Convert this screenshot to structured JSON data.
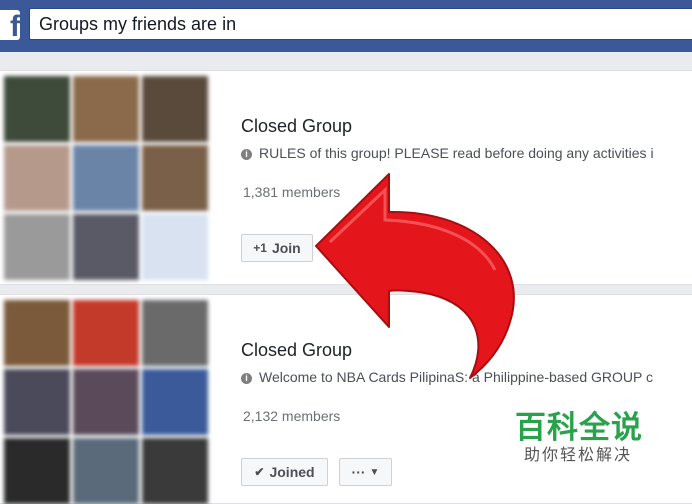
{
  "search": {
    "query": "Groups my friends are in"
  },
  "groups": [
    {
      "privacy": "Closed Group",
      "description": "RULES of this group! PLEASE read before doing any activities i",
      "members": "1,381 members",
      "join_label": "Join",
      "tiles": [
        "#3e4a3a",
        "#8a6a4a",
        "#5a4a3c",
        "#b59a8c",
        "#6a84a8",
        "#7a6048",
        "#9a9a9a",
        "#5a5a66",
        "#d8e2f0"
      ]
    },
    {
      "privacy": "Closed Group",
      "description": "Welcome to NBA Cards PilipinaS: a Philippine-based GROUP c",
      "members": "2,132 members",
      "joined_label": "Joined",
      "more_label": "···",
      "tiles": [
        "#7a5a3a",
        "#c43a2a",
        "#6a6a6a",
        "#4a4a5a",
        "#5a4a5a",
        "#3a5a9a",
        "#2a2a2a",
        "#5a6a7a",
        "#3a3a3a"
      ]
    }
  ],
  "watermark": {
    "title": "百科全说",
    "subtitle": "助你轻松解决"
  },
  "colors": {
    "topbar": "#3b5998",
    "arrow": "#e4161c",
    "watermark": "#2aa14b"
  }
}
